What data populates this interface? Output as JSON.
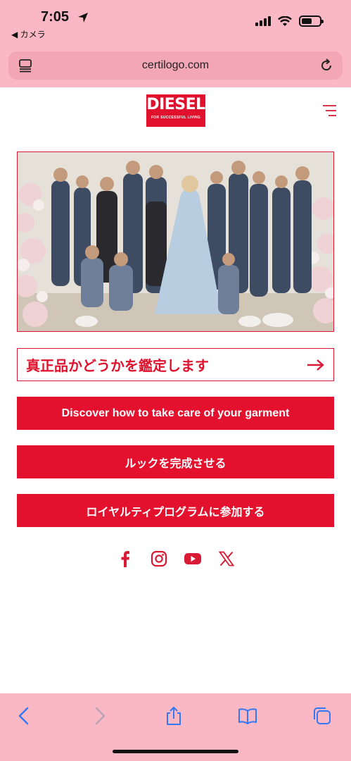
{
  "status": {
    "time": "7:05",
    "back_app": "◀ カメラ"
  },
  "browser": {
    "url": "certilogo.com"
  },
  "brand": {
    "logo_text": "DIESEL",
    "tagline": "FOR SUCCESSFUL LIVING",
    "accent_color": "#e4112e"
  },
  "actions": {
    "authenticate_label": "真正品かどうかを鑑定します",
    "care_label": "Discover how to take care of your garment",
    "complete_look_label": "ルックを完成させる",
    "loyalty_label": "ロイヤルティプログラムに参加する"
  },
  "social": [
    "facebook-icon",
    "instagram-icon",
    "youtube-icon",
    "x-icon"
  ],
  "toolbar_icons": [
    "back-icon",
    "forward-icon",
    "share-icon",
    "bookmarks-icon",
    "tabs-icon"
  ]
}
